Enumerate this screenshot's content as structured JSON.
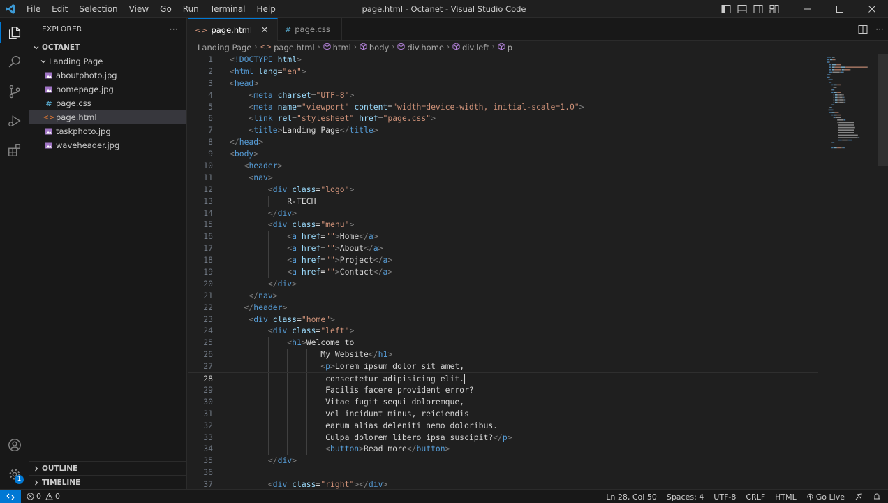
{
  "window": {
    "title": "page.html - Octanet - Visual Studio Code",
    "menu": [
      "File",
      "Edit",
      "Selection",
      "View",
      "Go",
      "Run",
      "Terminal",
      "Help"
    ]
  },
  "sidebar": {
    "header": "EXPLORER",
    "more": "···",
    "root": "OCTANET",
    "folder": "Landing Page",
    "files": [
      {
        "name": "aboutphoto.jpg",
        "type": "image"
      },
      {
        "name": "homepage.jpg",
        "type": "image"
      },
      {
        "name": "page.css",
        "type": "css"
      },
      {
        "name": "page.html",
        "type": "html",
        "selected": true
      },
      {
        "name": "taskphoto.jpg",
        "type": "image"
      },
      {
        "name": "waveheader.jpg",
        "type": "image"
      }
    ],
    "outline": "OUTLINE",
    "timeline": "TIMELINE"
  },
  "activity": {
    "accounts_badge": "1"
  },
  "tabs": [
    {
      "label": "page.html",
      "active": true
    },
    {
      "label": "page.css",
      "active": false
    }
  ],
  "breadcrumb": [
    "Landing Page",
    "page.html",
    "html",
    "body",
    "div.home",
    "div.left",
    "p"
  ],
  "editor": {
    "current_line": 28,
    "lines": [
      [
        [
          "punct",
          "<"
        ],
        [
          "tag",
          "!DOCTYPE"
        ],
        [
          "text",
          " "
        ],
        [
          "attr",
          "html"
        ],
        [
          "punct",
          ">"
        ]
      ],
      [
        [
          "punct",
          "<"
        ],
        [
          "tag",
          "html"
        ],
        [
          "text",
          " "
        ],
        [
          "attr",
          "lang"
        ],
        [
          "text",
          "="
        ],
        [
          "str",
          "\"en\""
        ],
        [
          "punct",
          ">"
        ]
      ],
      [
        [
          "punct",
          "<"
        ],
        [
          "tag",
          "head"
        ],
        [
          "punct",
          ">"
        ]
      ],
      [
        [
          "text",
          "    "
        ],
        [
          "punct",
          "<"
        ],
        [
          "tag",
          "meta"
        ],
        [
          "text",
          " "
        ],
        [
          "attr",
          "charset"
        ],
        [
          "text",
          "="
        ],
        [
          "str",
          "\"UTF-8\""
        ],
        [
          "punct",
          ">"
        ]
      ],
      [
        [
          "text",
          "    "
        ],
        [
          "punct",
          "<"
        ],
        [
          "tag",
          "meta"
        ],
        [
          "text",
          " "
        ],
        [
          "attr",
          "name"
        ],
        [
          "text",
          "="
        ],
        [
          "str",
          "\"viewport\""
        ],
        [
          "text",
          " "
        ],
        [
          "attr",
          "content"
        ],
        [
          "text",
          "="
        ],
        [
          "str",
          "\"width=device-width, initial-scale=1.0\""
        ],
        [
          "punct",
          ">"
        ]
      ],
      [
        [
          "text",
          "    "
        ],
        [
          "punct",
          "<"
        ],
        [
          "tag",
          "link"
        ],
        [
          "text",
          " "
        ],
        [
          "attr",
          "rel"
        ],
        [
          "text",
          "="
        ],
        [
          "str",
          "\"stylesheet\""
        ],
        [
          "text",
          " "
        ],
        [
          "attr",
          "href"
        ],
        [
          "text",
          "="
        ],
        [
          "str",
          "\""
        ],
        [
          "link",
          "page.css"
        ],
        [
          "str",
          "\""
        ],
        [
          "punct",
          ">"
        ]
      ],
      [
        [
          "text",
          "    "
        ],
        [
          "punct",
          "<"
        ],
        [
          "tag",
          "title"
        ],
        [
          "punct",
          ">"
        ],
        [
          "text",
          "Landing Page"
        ],
        [
          "punct",
          "</"
        ],
        [
          "tag",
          "title"
        ],
        [
          "punct",
          ">"
        ]
      ],
      [
        [
          "punct",
          "</"
        ],
        [
          "tag",
          "head"
        ],
        [
          "punct",
          ">"
        ]
      ],
      [
        [
          "punct",
          "<"
        ],
        [
          "tag",
          "body"
        ],
        [
          "punct",
          ">"
        ]
      ],
      [
        [
          "text",
          "   "
        ],
        [
          "punct",
          "<"
        ],
        [
          "tag",
          "header"
        ],
        [
          "punct",
          ">"
        ]
      ],
      [
        [
          "text",
          "    "
        ],
        [
          "punct",
          "<"
        ],
        [
          "tag",
          "nav"
        ],
        [
          "punct",
          ">"
        ]
      ],
      [
        [
          "text",
          "        "
        ],
        [
          "punct",
          "<"
        ],
        [
          "tag",
          "div"
        ],
        [
          "text",
          " "
        ],
        [
          "attr",
          "class"
        ],
        [
          "text",
          "="
        ],
        [
          "str",
          "\"logo\""
        ],
        [
          "punct",
          ">"
        ]
      ],
      [
        [
          "text",
          "            R-TECH"
        ]
      ],
      [
        [
          "text",
          "        "
        ],
        [
          "punct",
          "</"
        ],
        [
          "tag",
          "div"
        ],
        [
          "punct",
          ">"
        ]
      ],
      [
        [
          "text",
          "        "
        ],
        [
          "punct",
          "<"
        ],
        [
          "tag",
          "div"
        ],
        [
          "text",
          " "
        ],
        [
          "attr",
          "class"
        ],
        [
          "text",
          "="
        ],
        [
          "str",
          "\"menu\""
        ],
        [
          "punct",
          ">"
        ]
      ],
      [
        [
          "text",
          "            "
        ],
        [
          "punct",
          "<"
        ],
        [
          "tag",
          "a"
        ],
        [
          "text",
          " "
        ],
        [
          "attr",
          "href"
        ],
        [
          "text",
          "="
        ],
        [
          "str",
          "\"\""
        ],
        [
          "punct",
          ">"
        ],
        [
          "text",
          "Home"
        ],
        [
          "punct",
          "</"
        ],
        [
          "tag",
          "a"
        ],
        [
          "punct",
          ">"
        ]
      ],
      [
        [
          "text",
          "            "
        ],
        [
          "punct",
          "<"
        ],
        [
          "tag",
          "a"
        ],
        [
          "text",
          " "
        ],
        [
          "attr",
          "href"
        ],
        [
          "text",
          "="
        ],
        [
          "str",
          "\"\""
        ],
        [
          "punct",
          ">"
        ],
        [
          "text",
          "About"
        ],
        [
          "punct",
          "</"
        ],
        [
          "tag",
          "a"
        ],
        [
          "punct",
          ">"
        ]
      ],
      [
        [
          "text",
          "            "
        ],
        [
          "punct",
          "<"
        ],
        [
          "tag",
          "a"
        ],
        [
          "text",
          " "
        ],
        [
          "attr",
          "href"
        ],
        [
          "text",
          "="
        ],
        [
          "str",
          "\"\""
        ],
        [
          "punct",
          ">"
        ],
        [
          "text",
          "Project"
        ],
        [
          "punct",
          "</"
        ],
        [
          "tag",
          "a"
        ],
        [
          "punct",
          ">"
        ]
      ],
      [
        [
          "text",
          "            "
        ],
        [
          "punct",
          "<"
        ],
        [
          "tag",
          "a"
        ],
        [
          "text",
          " "
        ],
        [
          "attr",
          "href"
        ],
        [
          "text",
          "="
        ],
        [
          "str",
          "\"\""
        ],
        [
          "punct",
          ">"
        ],
        [
          "text",
          "Contact"
        ],
        [
          "punct",
          "</"
        ],
        [
          "tag",
          "a"
        ],
        [
          "punct",
          ">"
        ]
      ],
      [
        [
          "text",
          "        "
        ],
        [
          "punct",
          "</"
        ],
        [
          "tag",
          "div"
        ],
        [
          "punct",
          ">"
        ]
      ],
      [
        [
          "text",
          "    "
        ],
        [
          "punct",
          "</"
        ],
        [
          "tag",
          "nav"
        ],
        [
          "punct",
          ">"
        ]
      ],
      [
        [
          "text",
          "   "
        ],
        [
          "punct",
          "</"
        ],
        [
          "tag",
          "header"
        ],
        [
          "punct",
          ">"
        ]
      ],
      [
        [
          "text",
          "    "
        ],
        [
          "punct",
          "<"
        ],
        [
          "tag",
          "div"
        ],
        [
          "text",
          " "
        ],
        [
          "attr",
          "class"
        ],
        [
          "text",
          "="
        ],
        [
          "str",
          "\"home\""
        ],
        [
          "punct",
          ">"
        ]
      ],
      [
        [
          "text",
          "        "
        ],
        [
          "punct",
          "<"
        ],
        [
          "tag",
          "div"
        ],
        [
          "text",
          " "
        ],
        [
          "attr",
          "class"
        ],
        [
          "text",
          "="
        ],
        [
          "str",
          "\"left\""
        ],
        [
          "punct",
          ">"
        ]
      ],
      [
        [
          "text",
          "            "
        ],
        [
          "punct",
          "<"
        ],
        [
          "tag",
          "h1"
        ],
        [
          "punct",
          ">"
        ],
        [
          "text",
          "Welcome to"
        ]
      ],
      [
        [
          "text",
          "                   My Website"
        ],
        [
          "punct",
          "</"
        ],
        [
          "tag",
          "h1"
        ],
        [
          "punct",
          ">"
        ]
      ],
      [
        [
          "text",
          "                   "
        ],
        [
          "punct",
          "<"
        ],
        [
          "tag",
          "p"
        ],
        [
          "punct",
          ">"
        ],
        [
          "text",
          "Lorem ipsum dolor sit amet,"
        ]
      ],
      [
        [
          "text",
          "                    consectetur adipisicing elit."
        ]
      ],
      [
        [
          "text",
          "                    Facilis facere provident error?"
        ]
      ],
      [
        [
          "text",
          "                    Vitae fugit sequi doloremque,"
        ]
      ],
      [
        [
          "text",
          "                    vel incidunt minus, reiciendis"
        ]
      ],
      [
        [
          "text",
          "                    earum alias deleniti nemo doloribus."
        ]
      ],
      [
        [
          "text",
          "                    Culpa dolorem libero ipsa suscipit?"
        ],
        [
          "punct",
          "</"
        ],
        [
          "tag",
          "p"
        ],
        [
          "punct",
          ">"
        ]
      ],
      [
        [
          "text",
          "                    "
        ],
        [
          "punct",
          "<"
        ],
        [
          "tag",
          "button"
        ],
        [
          "punct",
          ">"
        ],
        [
          "text",
          "Read more"
        ],
        [
          "punct",
          "</"
        ],
        [
          "tag",
          "button"
        ],
        [
          "punct",
          ">"
        ]
      ],
      [
        [
          "text",
          "        "
        ],
        [
          "punct",
          "</"
        ],
        [
          "tag",
          "div"
        ],
        [
          "punct",
          ">"
        ]
      ],
      [
        [
          "text",
          ""
        ]
      ],
      [
        [
          "text",
          "        "
        ],
        [
          "punct",
          "<"
        ],
        [
          "tag",
          "div"
        ],
        [
          "text",
          " "
        ],
        [
          "attr",
          "class"
        ],
        [
          "text",
          "="
        ],
        [
          "str",
          "\"right\""
        ],
        [
          "punct",
          ">"
        ],
        [
          "punct",
          "</"
        ],
        [
          "tag",
          "div"
        ],
        [
          "punct",
          ">"
        ]
      ]
    ]
  },
  "statusbar": {
    "errors": "0",
    "warnings": "0",
    "position": "Ln 28, Col 50",
    "spaces": "Spaces: 4",
    "encoding": "UTF-8",
    "eol": "CRLF",
    "language": "HTML",
    "golive": "Go Live"
  },
  "colors": {
    "accent": "#0078d4",
    "tag": "#569cd6",
    "attribute": "#9cdcfe",
    "string": "#ce9178",
    "background": "#1f1f1f"
  }
}
